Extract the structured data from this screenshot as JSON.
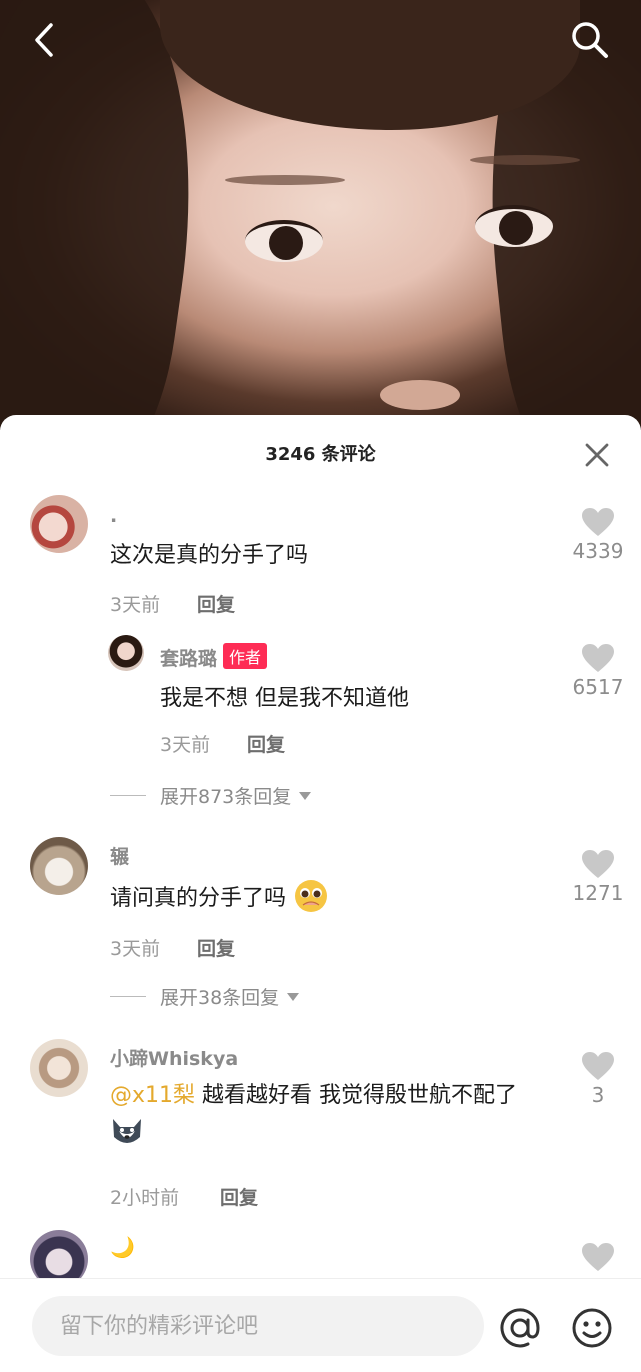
{
  "header": {
    "back_icon": "back-arrow-icon",
    "search_icon": "search-icon"
  },
  "sheet": {
    "title": "3246 条评论",
    "close_icon": "close-icon"
  },
  "comments": [
    {
      "user": ".",
      "text": "这次是真的分手了吗",
      "time": "3天前",
      "reply_label": "回复",
      "likes": "4339"
    },
    {
      "user": "套路璐",
      "badge": "作者",
      "text": "我是不想 但是我不知道他",
      "time": "3天前",
      "reply_label": "回复",
      "likes": "6517"
    },
    {
      "expand": "展开873条回复"
    },
    {
      "user": "辗",
      "text": "请问真的分手了吗",
      "emoji": "pleading-face-emoji",
      "time": "3天前",
      "reply_label": "回复",
      "likes": "1271"
    },
    {
      "expand": "展开38条回复"
    },
    {
      "user": "小蹄Whiskya",
      "mention": "@x11梨",
      "text": " 越看越好看 我觉得殷世航不配了",
      "emoji": "husky-emoji",
      "time": "2小时前",
      "reply_label": "回复",
      "likes": "3"
    },
    {
      "user": "🌙"
    }
  ],
  "bottom": {
    "placeholder": "留下你的精彩评论吧",
    "at_icon": "at-icon",
    "emoji_icon": "smile-icon"
  }
}
